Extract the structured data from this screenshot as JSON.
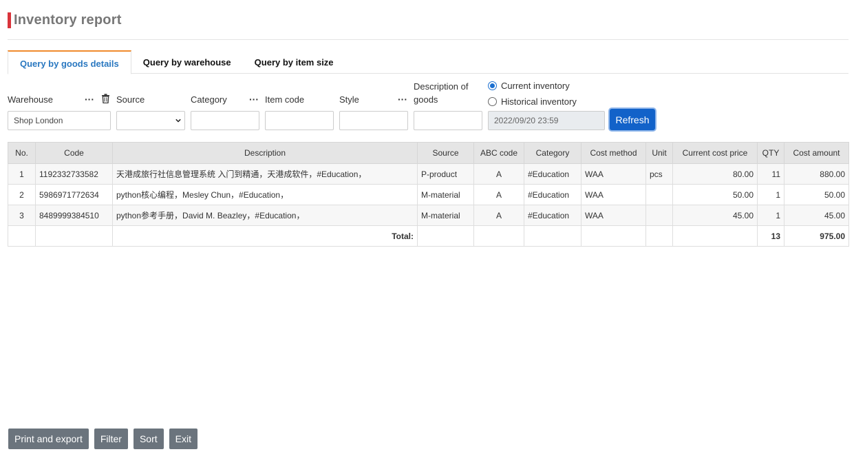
{
  "page": {
    "title": "Inventory report",
    "accent_color": "#d9343b"
  },
  "tabs": [
    {
      "label": "Query by goods details",
      "active": true
    },
    {
      "label": "Query by warehouse",
      "active": false
    },
    {
      "label": "Query by item size",
      "active": false
    }
  ],
  "filters": {
    "warehouse_label": "Warehouse",
    "warehouse_value": "Shop London",
    "source_label": "Source",
    "source_value": "",
    "category_label": "Category",
    "category_value": "",
    "item_code_label": "Item code",
    "item_code_value": "",
    "style_label": "Style",
    "style_value": "",
    "description_label_1": "Description of",
    "description_label_2": "goods",
    "description_value": "",
    "current_inventory_label": "Current inventory",
    "historical_inventory_label": "Historical inventory",
    "selected_mode": "current",
    "datetime_value": "2022/09/20 23:59",
    "refresh_label": "Refresh",
    "more_icon": "···"
  },
  "table": {
    "headers": [
      "No.",
      "Code",
      "Description",
      "Source",
      "ABC code",
      "Category",
      "Cost method",
      "Unit",
      "Current cost price",
      "QTY",
      "Cost amount"
    ],
    "rows": [
      {
        "no": "1",
        "code": "1192332733582",
        "description": "天港成旅行社信息管理系统 入门到精通，天港成软件，#Education，",
        "source": "P-product",
        "abc": "A",
        "category": "#Education",
        "cost_method": "WAA",
        "unit": "pcs",
        "price": "80.00",
        "qty": "11",
        "amount": "880.00"
      },
      {
        "no": "2",
        "code": "5986971772634",
        "description": "python核心编程，Mesley Chun，#Education，",
        "source": "M-material",
        "abc": "A",
        "category": "#Education",
        "cost_method": "WAA",
        "unit": "",
        "price": "50.00",
        "qty": "1",
        "amount": "50.00"
      },
      {
        "no": "3",
        "code": "8489999384510",
        "description": "python参考手册，David M. Beazley，#Education，",
        "source": "M-material",
        "abc": "A",
        "category": "#Education",
        "cost_method": "WAA",
        "unit": "",
        "price": "45.00",
        "qty": "1",
        "amount": "45.00"
      }
    ],
    "total_label": "Total:",
    "total_qty": "13",
    "total_amount": "975.00"
  },
  "actions": {
    "print_export": "Print and export",
    "filter": "Filter",
    "sort": "Sort",
    "exit": "Exit"
  }
}
